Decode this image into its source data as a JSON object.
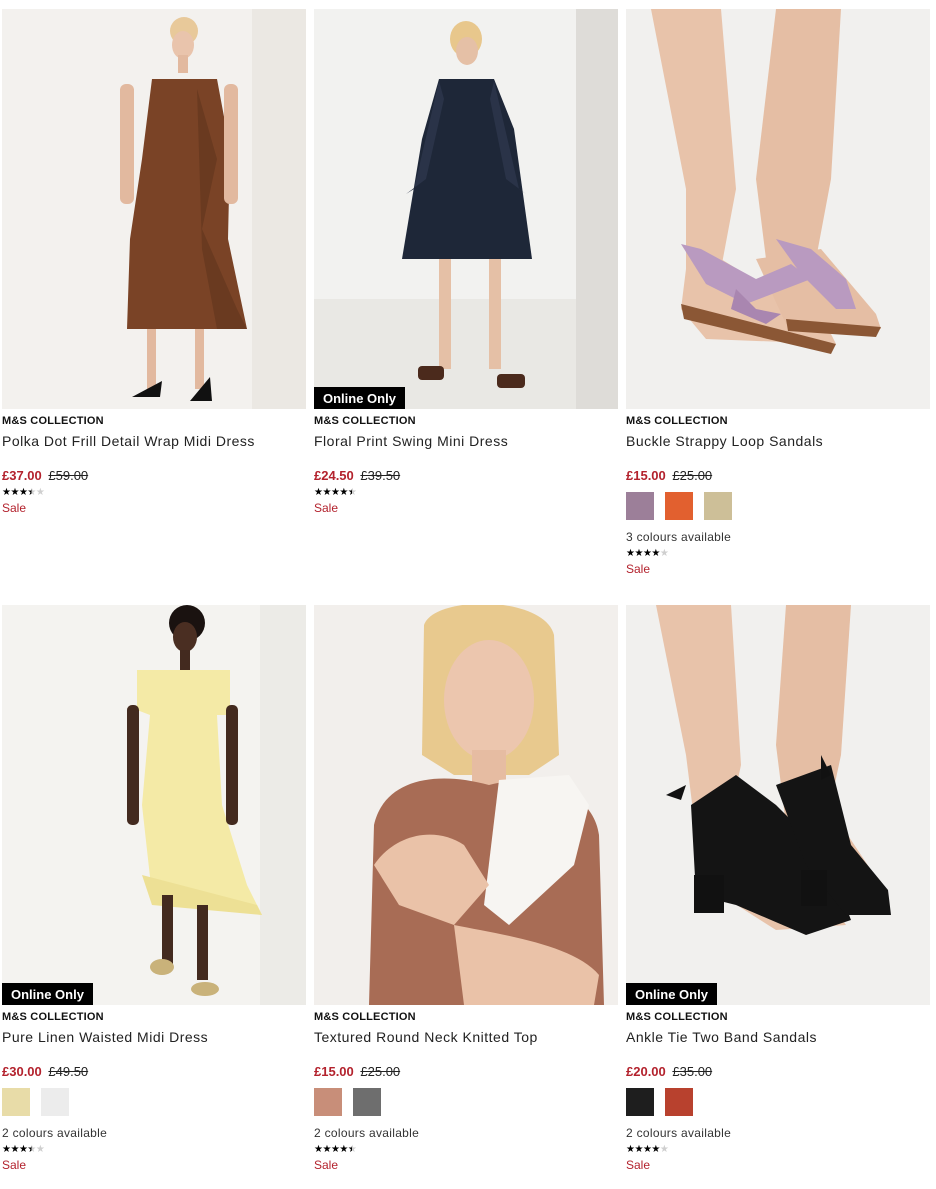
{
  "products": [
    {
      "brand": "M&S COLLECTION",
      "title": "Polka Dot Frill Detail Wrap Midi Dress",
      "price_now": "£37.00",
      "price_was": "£59.00",
      "rating": 3.5,
      "sale": "Sale",
      "badge": "",
      "colours_text": "",
      "swatches": []
    },
    {
      "brand": "M&S COLLECTION",
      "title": "Floral Print Swing Mini Dress",
      "price_now": "£24.50",
      "price_was": "£39.50",
      "rating": 4.5,
      "sale": "Sale",
      "badge": "Online Only",
      "colours_text": "",
      "swatches": []
    },
    {
      "brand": "M&S COLLECTION",
      "title": "Buckle Strappy Loop Sandals",
      "price_now": "£15.00",
      "price_was": "£25.00",
      "rating": 4,
      "sale": "Sale",
      "badge": "",
      "colours_text": "3 colours available",
      "swatches": [
        "#9c7f99",
        "#e2602f",
        "#cdbf98"
      ]
    },
    {
      "brand": "M&S COLLECTION",
      "title": "Pure Linen Waisted Midi Dress",
      "price_now": "£30.00",
      "price_was": "£49.50",
      "rating": 3.5,
      "sale": "Sale",
      "badge": "Online Only",
      "colours_text": "2 colours available",
      "swatches": [
        "#e8dca8",
        "#ececec"
      ]
    },
    {
      "brand": "M&S COLLECTION",
      "title": "Textured Round Neck Knitted Top",
      "price_now": "£15.00",
      "price_was": "£25.00",
      "rating": 4.5,
      "sale": "Sale",
      "badge": "",
      "colours_text": "2 colours available",
      "swatches": [
        "#c88e79",
        "#6e6e6e"
      ]
    },
    {
      "brand": "M&S COLLECTION",
      "title": "Ankle Tie Two Band Sandals",
      "price_now": "£20.00",
      "price_was": "£35.00",
      "rating": 4,
      "sale": "Sale",
      "badge": "Online Only",
      "colours_text": "2 colours available",
      "swatches": [
        "#1e1e1e",
        "#b8412e"
      ]
    }
  ],
  "colors": {
    "sale_red": "#b3222d",
    "badge_bg": "#000000"
  }
}
